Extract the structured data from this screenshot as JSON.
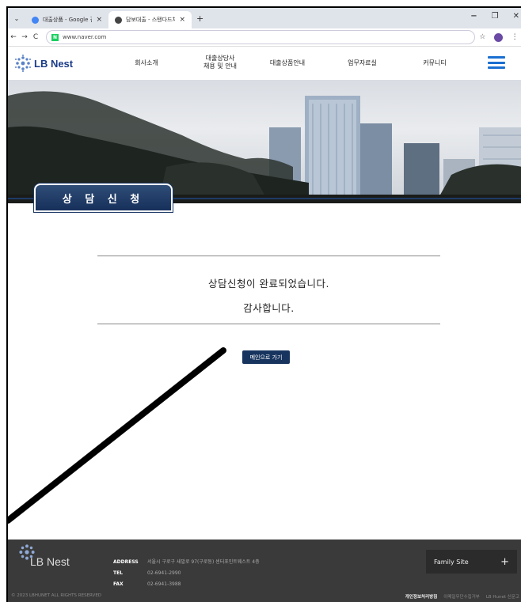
{
  "browser": {
    "tabs": [
      {
        "title": "대출상품 - Google 검색",
        "favicon_color": "#4285f4",
        "active": false
      },
      {
        "title": "담보대출 - 스탠다드차타드",
        "favicon_color": "#444444",
        "active": true
      }
    ],
    "new_tab": "+",
    "url": "www.naver.com",
    "window_controls": [
      "−",
      "⌐",
      "✕"
    ]
  },
  "site": {
    "logo": "LB Nest",
    "nav": [
      "회사소개",
      "대출상담사",
      "채용 및 안내",
      "대출상품안내",
      "업무자료실",
      "커뮤니티"
    ]
  },
  "page": {
    "tab_title": "상 담 신 청",
    "message_line1": "상담신청이 완료되었습니다.",
    "message_line2": "감사합니다.",
    "main_button": "메인으로 가기"
  },
  "footer": {
    "logo": "LB Nest",
    "address_label": "ADDRESS",
    "address": "서울시 구로구 새말로 97(구로동) 센터포인트웨스트 4층",
    "tel_label": "TEL",
    "tel": "02-6941-2990",
    "fax_label": "FAX",
    "fax": "02-6941-3988",
    "family_site": "Family Site",
    "family_plus": "+",
    "copyright": "© 2023 LBHUNET ALL RIGHTS RESERVED",
    "links": [
      "개인정보처리방침",
      "이메일무단수집거부",
      "LB Hunet 신문고"
    ]
  },
  "colors": {
    "navy": "#17345f",
    "accent_blue": "#1b6fd1",
    "footer_bg": "#3a3a3a"
  }
}
